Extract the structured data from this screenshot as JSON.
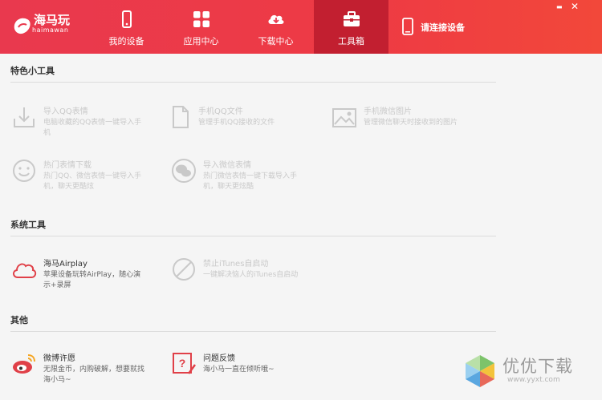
{
  "header": {
    "logo_text": "海马玩",
    "logo_sub": "haimawan",
    "nav": [
      {
        "label": "我的设备",
        "icon": "phone-icon"
      },
      {
        "label": "应用中心",
        "icon": "apps-grid-icon"
      },
      {
        "label": "下载中心",
        "icon": "cloud-download-icon"
      },
      {
        "label": "工具箱",
        "icon": "toolbox-icon",
        "active": true
      }
    ],
    "connect_label": "请连接设备",
    "minimize": "▬",
    "close": "✕"
  },
  "sections": {
    "featured": {
      "title": "特色小工具",
      "tools": [
        {
          "name": "导入QQ表情",
          "desc": "电脑收藏的QQ表情一键导入手机",
          "icon": "download-tray-icon"
        },
        {
          "name": "手机QQ文件",
          "desc": "管理手机QQ接收的文件",
          "icon": "file-icon"
        },
        {
          "name": "手机微信图片",
          "desc": "管理微信聊天时接收到的图片",
          "icon": "image-icon"
        },
        {
          "name": "热门表情下载",
          "desc": "热门QQ、微信表情一键导入手机，聊天更酷炫",
          "icon": "smiley-icon"
        },
        {
          "name": "导入微信表情",
          "desc": "热门微信表情一键下载导入手机，聊天更炫酷",
          "icon": "wechat-icon"
        }
      ]
    },
    "system": {
      "title": "系统工具",
      "tools": [
        {
          "name": "海马Airplay",
          "desc": "苹果设备玩转AirPlay，随心演示+录屏",
          "icon": "cloud-outline-icon"
        },
        {
          "name": "禁止iTunes自启动",
          "desc": "一键解决恼人的iTunes自启动",
          "icon": "forbidden-icon"
        }
      ]
    },
    "other": {
      "title": "其他",
      "tools": [
        {
          "name": "微博许愿",
          "desc": "无限金币，内购破解，想要就找海小马~",
          "icon": "weibo-icon"
        },
        {
          "name": "问题反馈",
          "desc": "海小马一直在倾听哦~",
          "icon": "feedback-icon"
        }
      ]
    }
  },
  "watermark": {
    "text": "优优下载",
    "url": "www.yyxt.com"
  },
  "colors": {
    "accent": "#e9394e",
    "active_tab": "#c21f30",
    "brand_red": "#e04048"
  }
}
